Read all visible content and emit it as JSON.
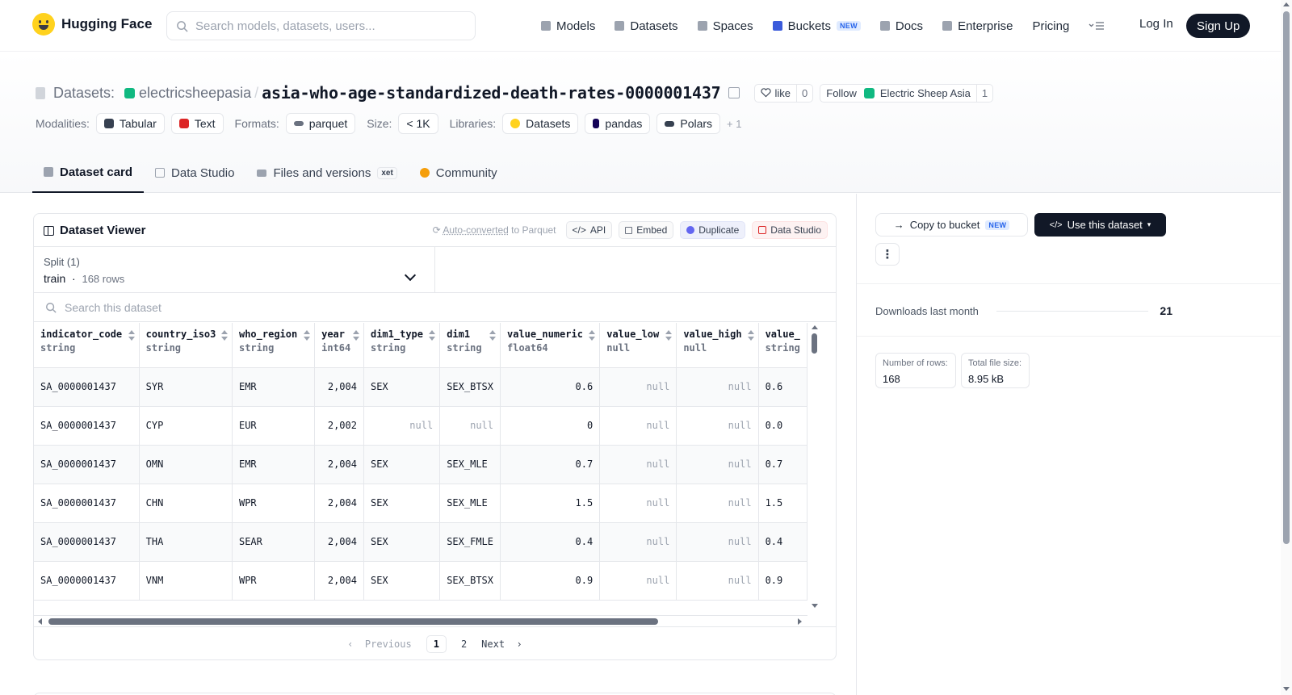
{
  "nav": {
    "logo_text": "Hugging Face",
    "search_placeholder": "Search models, datasets, users...",
    "links": [
      {
        "label": "Models",
        "icon": "cube-icon"
      },
      {
        "label": "Datasets",
        "icon": "database-icon"
      },
      {
        "label": "Spaces",
        "icon": "grid-icon"
      },
      {
        "label": "Buckets",
        "icon": "bucket-icon",
        "badge": "NEW"
      },
      {
        "label": "Docs",
        "icon": "book-icon"
      },
      {
        "label": "Enterprise",
        "icon": "enterprise-icon"
      },
      {
        "label": "Pricing"
      }
    ],
    "login": "Log In",
    "signup": "Sign Up"
  },
  "header": {
    "type_label": "Datasets:",
    "org": "electricsheepasia",
    "slash": "/",
    "name": "asia-who-age-standardized-death-rates-0000001437",
    "like_label": "like",
    "like_count": "0",
    "follow_label": "Follow",
    "follow_org": "Electric Sheep Asia",
    "follow_count": "1"
  },
  "tags": {
    "modalities_label": "Modalities:",
    "modalities": [
      "Tabular",
      "Text"
    ],
    "formats_label": "Formats:",
    "format": "parquet",
    "size_label": "Size:",
    "size": "< 1K",
    "libraries_label": "Libraries:",
    "libraries": [
      "Datasets",
      "pandas",
      "Polars"
    ],
    "more": "+ 1"
  },
  "tabs": [
    {
      "label": "Dataset card",
      "active": true
    },
    {
      "label": "Data Studio"
    },
    {
      "label": "Files and versions",
      "badge": "xet"
    },
    {
      "label": "Community"
    }
  ],
  "viewer": {
    "title": "Dataset Viewer",
    "auto_converted_link": "Auto-converted",
    "auto_converted_rest": " to Parquet",
    "actions": [
      "API",
      "Embed",
      "Duplicate",
      "Data Studio"
    ],
    "split_label": "Split (1)",
    "split_value": "train",
    "split_rows": "168 rows",
    "search_placeholder": "Search this dataset",
    "columns": [
      {
        "name": "indicator_code",
        "type": "string"
      },
      {
        "name": "country_iso3",
        "type": "string"
      },
      {
        "name": "who_region",
        "type": "string"
      },
      {
        "name": "year",
        "type": "int64"
      },
      {
        "name": "dim1_type",
        "type": "string"
      },
      {
        "name": "dim1",
        "type": "string"
      },
      {
        "name": "value_numeric",
        "type": "float64"
      },
      {
        "name": "value_low",
        "type": "null"
      },
      {
        "name": "value_high",
        "type": "null"
      },
      {
        "name": "value_",
        "type": "string"
      }
    ],
    "rows": [
      [
        "SA_0000001437",
        "SYR",
        "EMR",
        "2,004",
        "SEX",
        "SEX_BTSX",
        "0.6",
        "null",
        "null",
        "0.6"
      ],
      [
        "SA_0000001437",
        "CYP",
        "EUR",
        "2,002",
        "null",
        "null",
        "0",
        "null",
        "null",
        "0.0"
      ],
      [
        "SA_0000001437",
        "OMN",
        "EMR",
        "2,004",
        "SEX",
        "SEX_MLE",
        "0.7",
        "null",
        "null",
        "0.7"
      ],
      [
        "SA_0000001437",
        "CHN",
        "WPR",
        "2,004",
        "SEX",
        "SEX_MLE",
        "1.5",
        "null",
        "null",
        "1.5"
      ],
      [
        "SA_0000001437",
        "THA",
        "SEAR",
        "2,004",
        "SEX",
        "SEX_FMLE",
        "0.4",
        "null",
        "null",
        "0.4"
      ],
      [
        "SA_0000001437",
        "VNM",
        "WPR",
        "2,004",
        "SEX",
        "SEX_BTSX",
        "0.9",
        "null",
        "null",
        "0.9"
      ]
    ],
    "pager": {
      "prev": "Previous",
      "pages": [
        "1",
        "2"
      ],
      "current": "1",
      "next": "Next"
    }
  },
  "sidebar": {
    "copy_to_bucket": "Copy to bucket",
    "copy_badge": "NEW",
    "use_dataset": "Use this dataset",
    "more": "⋮",
    "downloads_label": "Downloads last month",
    "downloads_value": "21",
    "rows_label": "Number of rows:",
    "rows_value": "168",
    "size_label": "Total file size:",
    "size_value": "8.95 kB"
  },
  "colors": {
    "accent": "#111827",
    "org_green": "#10b981",
    "hf_yellow": "#ffd21e"
  }
}
